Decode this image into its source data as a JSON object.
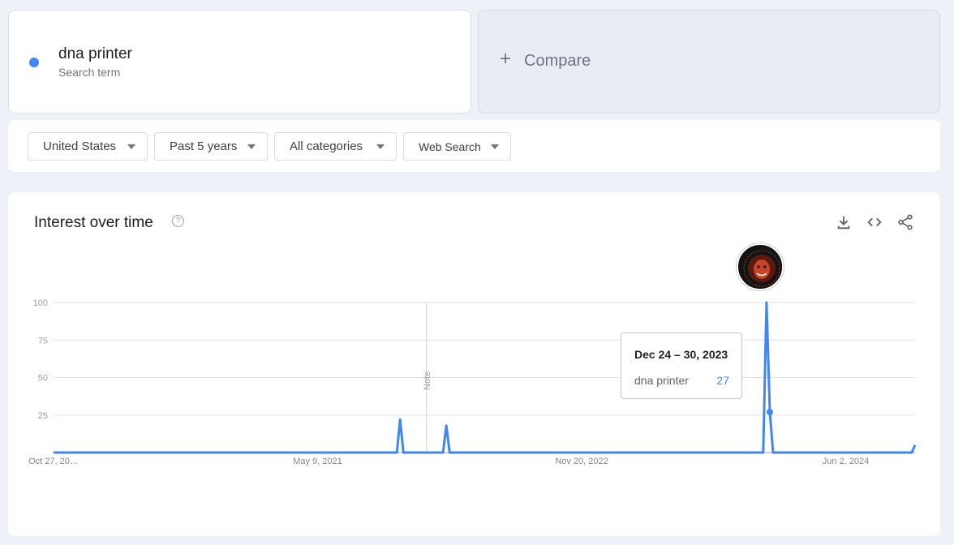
{
  "search_term": {
    "name": "dna printer",
    "subtitle": "Search term",
    "color": "#4285f4"
  },
  "compare": {
    "plus": "+",
    "label": "Compare"
  },
  "filters": [
    {
      "label": "United States"
    },
    {
      "label": "Past 5 years"
    },
    {
      "label": "All categories"
    },
    {
      "label": "Web Search"
    }
  ],
  "card": {
    "title": "Interest over time",
    "help": "?",
    "actions": [
      "download-icon",
      "embed-icon",
      "share-icon"
    ]
  },
  "tooltip": {
    "date": "Dec 24 – 30, 2023",
    "term": "dna printer",
    "value": "27"
  },
  "annotation": {
    "note_label": "Note",
    "note_week_index": 113,
    "event_badge": "The Joe Rogan Experience",
    "event_week_index": 216
  },
  "chart_data": {
    "type": "line",
    "title": "Interest over time",
    "xlabel": "",
    "ylabel": "",
    "ylim": [
      0,
      100
    ],
    "yticks": [
      25,
      50,
      75,
      100
    ],
    "grid": true,
    "x_start": "Oct 27, 2019",
    "x_interval": "weekly",
    "num_points": 262,
    "xtick_labels": [
      {
        "label": "Oct 27, 20…",
        "week_index": 0
      },
      {
        "label": "May 9, 2021",
        "week_index": 80
      },
      {
        "label": "Nov 20, 2022",
        "week_index": 160
      },
      {
        "label": "Jun 2, 2024",
        "week_index": 240
      }
    ],
    "series": [
      {
        "name": "dna printer",
        "color": "#4285f4",
        "default_value": 0,
        "nonzero_points": [
          {
            "week_index": 105,
            "value": 22
          },
          {
            "week_index": 119,
            "value": 18
          },
          {
            "week_index": 216,
            "value": 100
          },
          {
            "week_index": 217,
            "value": 27
          },
          {
            "week_index": 261,
            "value": 5
          }
        ]
      }
    ],
    "highlighted_point": {
      "week_index": 217,
      "value": 27,
      "label": "Dec 24 – 30, 2023"
    }
  }
}
